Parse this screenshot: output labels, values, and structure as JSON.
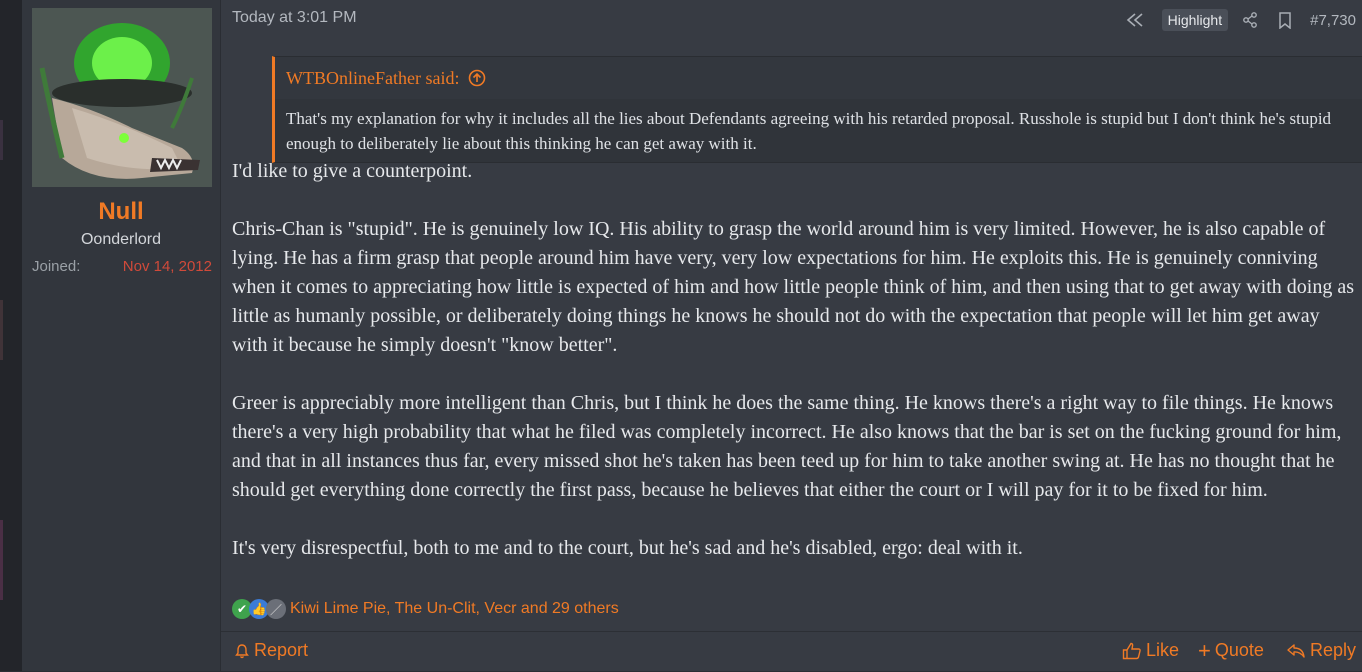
{
  "user": {
    "name": "Null",
    "title": "Oonderlord",
    "joined_label": "Joined:",
    "joined_date": "Nov 14, 2012"
  },
  "post": {
    "date": "Today at 3:01 PM",
    "highlight_label": "Highlight",
    "number": "#7,730",
    "quote": {
      "author": "WTBOnlineFather said:",
      "text": "That's my explanation for why it includes all the lies about Defendants agreeing with his retarded proposal. Russhole is stupid but I don't think he's stupid enough to deliberately lie about this thinking he can get away with it."
    },
    "paragraphs": [
      "I'd like to give a counterpoint.",
      "Chris-Chan is \"stupid\". He is genuinely low IQ. His ability to grasp the world around him is very limited. However, he is also capable of lying. He has a firm grasp that people around him have very, very low expectations for him. He exploits this. He is genuinely conniving when it comes to appreciating how little is expected of him and how little people think of him, and then using that to get away with doing as little as humanly possible, or deliberately doing things he knows he should not do with the expectation that people will let him get away with it because he simply doesn't \"know better\".",
      "Greer is appreciably more intelligent than Chris, but I think he does the same thing. He knows there's a right way to file things. He knows there's a very high probability that what he filed was completely incorrect. He also knows that the bar is set on the fucking ground for him, and that in all instances thus far, every missed shot he's taken has been teed up for him to take another swing at. He has no thought that he should get everything done correctly the first pass, because he believes that either the court or I will pay for it to be fixed for him.",
      "It's very disrespectful, both to me and to the court, but he's sad and he's disabled, ergo: deal with it."
    ],
    "reactions_text": "Kiwi Lime Pie, The Un-Clit, Vecr and 29 others"
  },
  "actions": {
    "report": "Report",
    "like": "Like",
    "quote": "Quote",
    "reply": "Reply"
  },
  "colors": {
    "accent": "#f07a25",
    "joined_date": "#d04a3a"
  }
}
